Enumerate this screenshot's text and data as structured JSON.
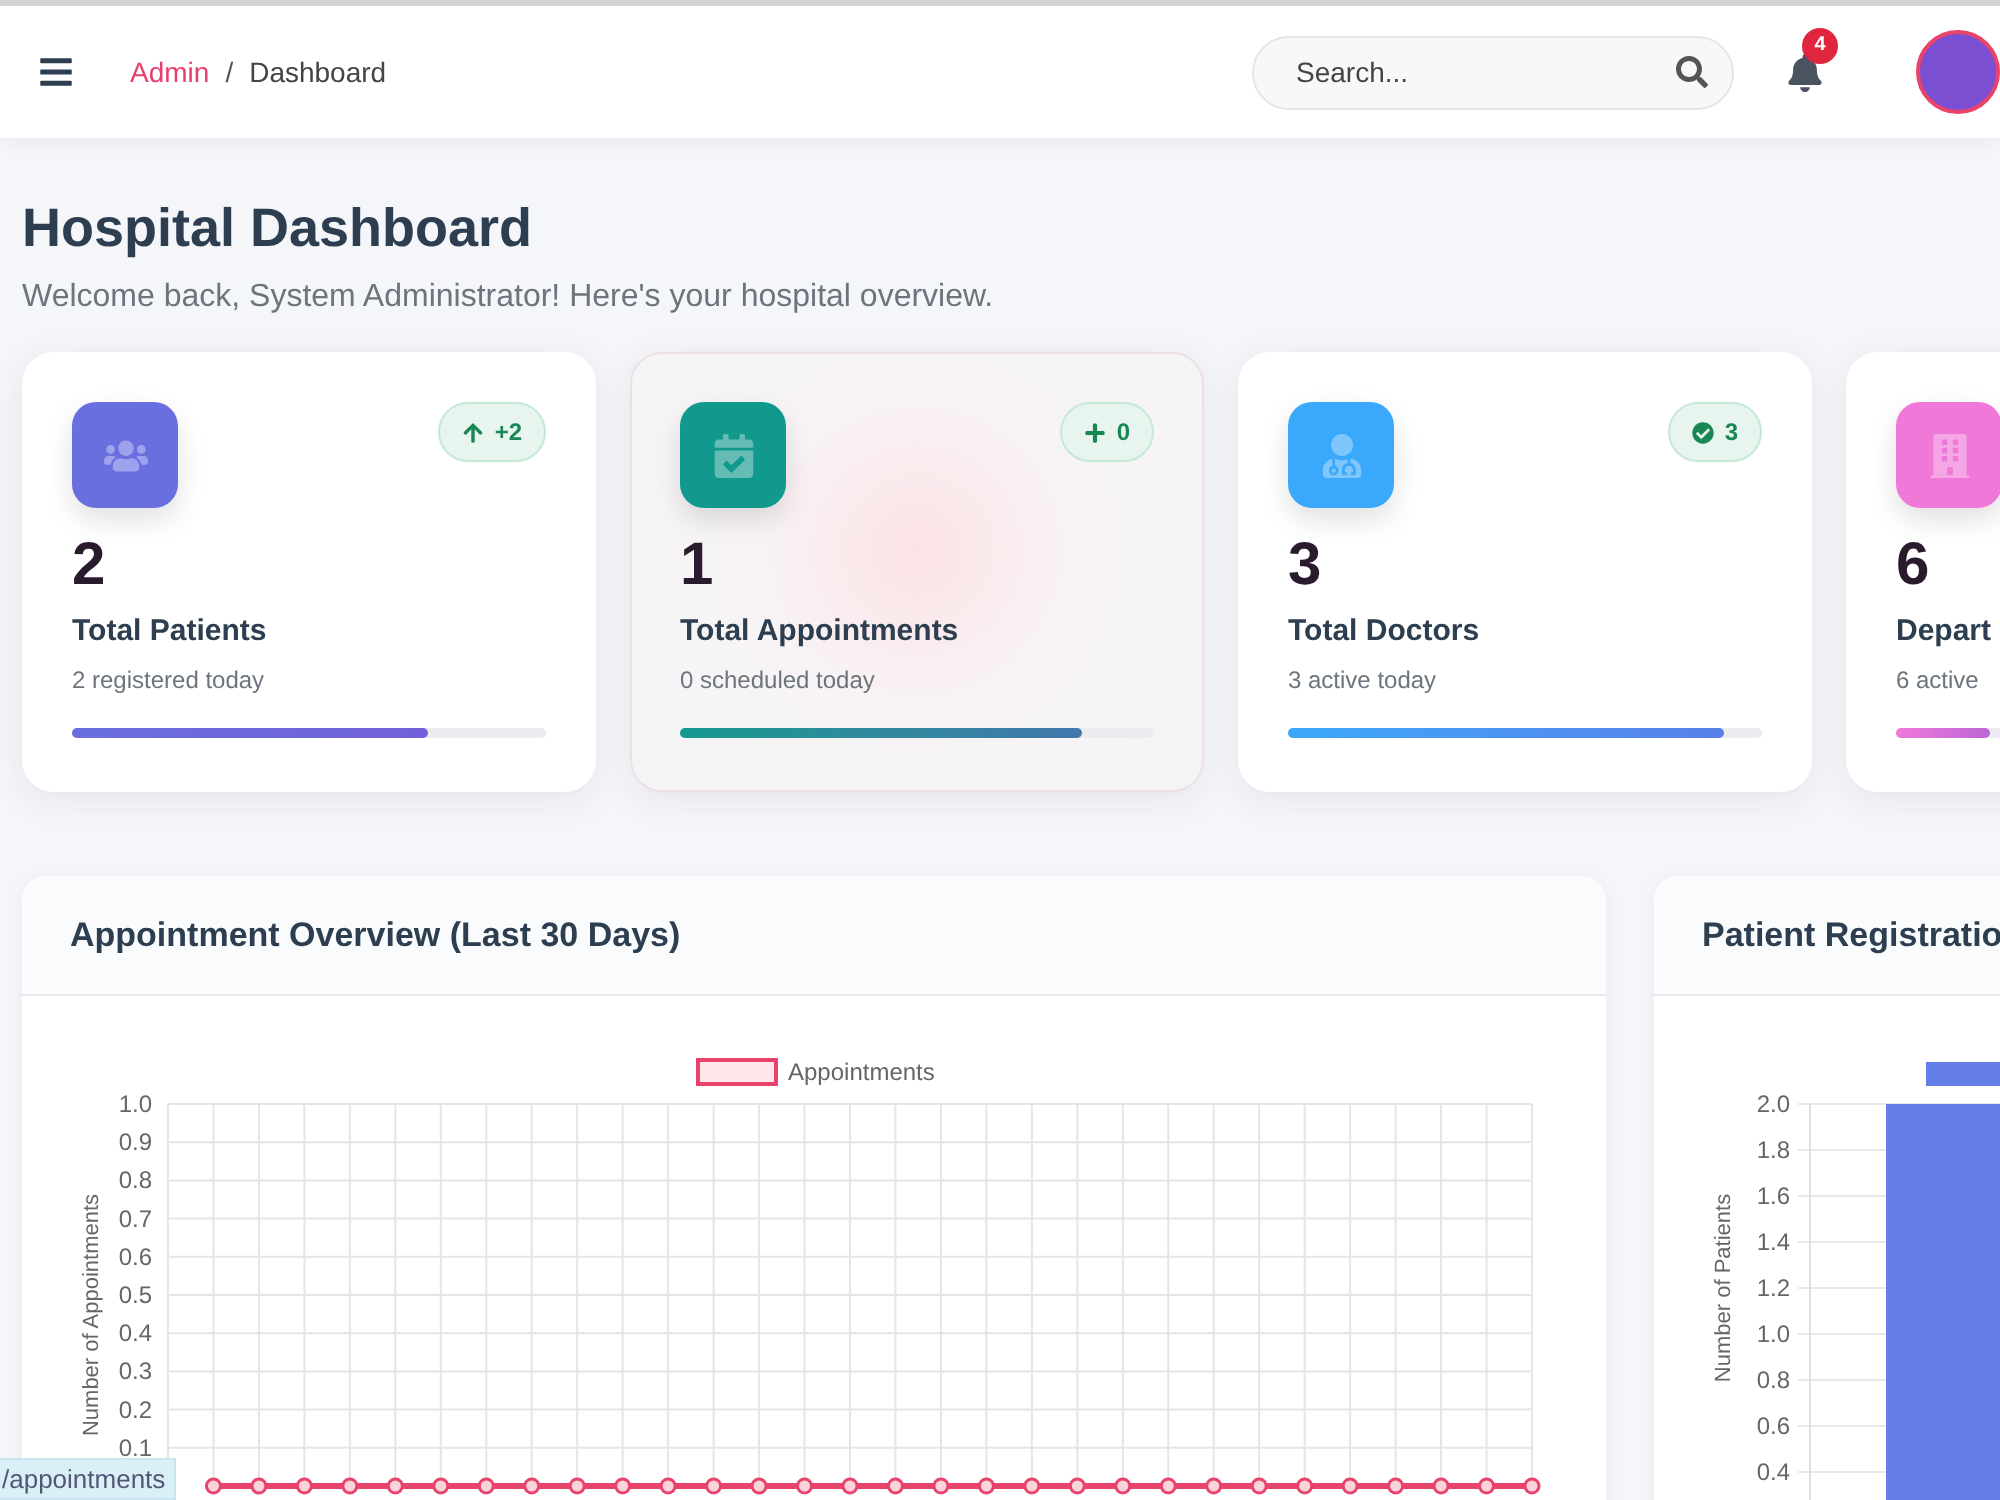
{
  "header": {
    "breadcrumb": [
      {
        "label": "Admin",
        "selected": false
      },
      {
        "label": "Dashboard",
        "selected": true
      }
    ],
    "separator": "/",
    "search": {
      "placeholder": "Search..."
    },
    "notifications": "4"
  },
  "page": {
    "title": "Hospital Dashboard",
    "subtitle": "Welcome back, System Administrator! Here's your hospital overview."
  },
  "stats": [
    {
      "kind": "users",
      "value": "2",
      "title": "Total Patients",
      "subtitle": "2 registered today",
      "badge": {
        "kind": "up",
        "text": "+2"
      },
      "level": 0.75,
      "color": "#6a6fe0",
      "highlighted": false
    },
    {
      "kind": "calendar",
      "value": "1",
      "title": "Total Appointments",
      "subtitle": "0 scheduled today",
      "badge": {
        "kind": "plus",
        "text": "0"
      },
      "level": 0.85,
      "color": "#11998e",
      "highlighted": true
    },
    {
      "kind": "doctor",
      "value": "3",
      "title": "Total Doctors",
      "subtitle": "3 active today",
      "badge": {
        "kind": "check",
        "text": "3"
      },
      "level": 0.92,
      "color": "#3aa8fb",
      "highlighted": false
    },
    {
      "kind": "building",
      "value": "6",
      "title": "Depart",
      "subtitle": "6 active",
      "level": 0.2,
      "color": "#f078d8",
      "highlighted": false
    }
  ],
  "charts": [
    {
      "title": "Appointment Overview (Last 30 Days)",
      "chart_data": {
        "type": "line",
        "ylabel": "Number of Appointments",
        "ylim": [
          0,
          1
        ],
        "grid": true,
        "yticks": [
          {
            "value": 0.1,
            "label": "0.1"
          },
          {
            "value": 0.2,
            "label": "0.2"
          },
          {
            "value": 0.3,
            "label": "0.3"
          },
          {
            "value": 0.4,
            "label": "0.4"
          },
          {
            "value": 0.5,
            "label": "0.5"
          },
          {
            "value": 0.6,
            "label": "0.6"
          },
          {
            "value": 0.7,
            "label": "0.7"
          },
          {
            "value": 0.8,
            "label": "0.8"
          },
          {
            "value": 0.9,
            "label": "0.9"
          },
          {
            "value": 1.0,
            "label": "1.0"
          }
        ],
        "series": [
          {
            "name": "Appointments",
            "color": "#e8436a",
            "marker": true,
            "values": [
              null,
              0,
              0,
              0,
              0,
              0,
              0,
              0,
              0,
              0,
              0,
              0,
              0,
              0,
              0,
              0,
              0,
              0,
              0,
              0,
              0,
              0,
              0,
              0,
              0,
              0,
              0,
              0,
              0,
              0,
              0
            ]
          }
        ]
      }
    },
    {
      "title": "Patient Registratio",
      "chart_data": {
        "type": "bar",
        "ylabel": "Number of Patients",
        "ylim": [
          0,
          2
        ],
        "grid": true,
        "yticks": [
          {
            "value": 0.4,
            "label": "0.4"
          },
          {
            "value": 0.6,
            "label": "0.6"
          },
          {
            "value": 0.8,
            "label": "0.8"
          },
          {
            "value": 1.0,
            "label": "1.0"
          },
          {
            "value": 1.2,
            "label": "1.2"
          },
          {
            "value": 1.4,
            "label": "1.4"
          },
          {
            "value": 1.6,
            "label": "1.6"
          },
          {
            "value": 1.8,
            "label": "1.8"
          },
          {
            "value": 2.0,
            "label": "2.0"
          }
        ],
        "series": [
          {
            "color": "#667eea",
            "values": [
              2
            ]
          }
        ]
      }
    }
  ],
  "status_link": "/appointments"
}
